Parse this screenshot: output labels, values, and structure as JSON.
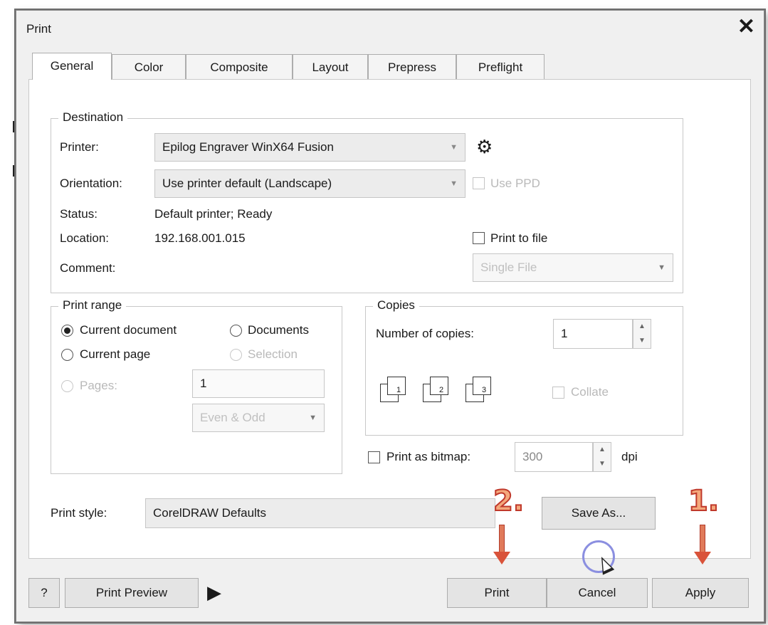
{
  "window": {
    "title": "Print",
    "close_glyph": "✕"
  },
  "tabs": [
    "General",
    "Color",
    "Composite",
    "Layout",
    "Prepress",
    "Preflight"
  ],
  "destination": {
    "title": "Destination",
    "printer_label": "Printer:",
    "printer_value": "Epilog Engraver WinX64 Fusion",
    "orientation_label": "Orientation:",
    "orientation_value": "Use printer default (Landscape)",
    "use_ppd_label": "Use PPD",
    "status_label": "Status:",
    "status_value": "Default printer; Ready",
    "location_label": "Location:",
    "location_value": "192.168.001.015",
    "comment_label": "Comment:",
    "print_to_file_label": "Print to file",
    "single_file_value": "Single File"
  },
  "print_range": {
    "title": "Print range",
    "current_document": "Current document",
    "documents": "Documents",
    "current_page": "Current page",
    "selection": "Selection",
    "pages_label": "Pages:",
    "pages_value": "1",
    "even_odd_value": "Even & Odd"
  },
  "copies": {
    "title": "Copies",
    "number_label": "Number of copies:",
    "number_value": "1",
    "collate_label": "Collate",
    "collate_icons": [
      "1",
      "2",
      "3"
    ]
  },
  "bitmap": {
    "label": "Print as bitmap:",
    "dpi_value": "300",
    "dpi_unit": "dpi"
  },
  "print_style": {
    "label": "Print style:",
    "value": "CorelDRAW Defaults",
    "save_as_label": "Save As..."
  },
  "footer": {
    "help_label": "?",
    "print_preview_label": "Print Preview",
    "print_label": "Print",
    "cancel_label": "Cancel",
    "apply_label": "Apply"
  },
  "annotations": {
    "step1": "1.",
    "step2": "2."
  },
  "colors": {
    "annotation_fill": "#f4a87c",
    "annotation_stroke": "#c0392b",
    "highlight_circle": "#8b8fe0"
  }
}
